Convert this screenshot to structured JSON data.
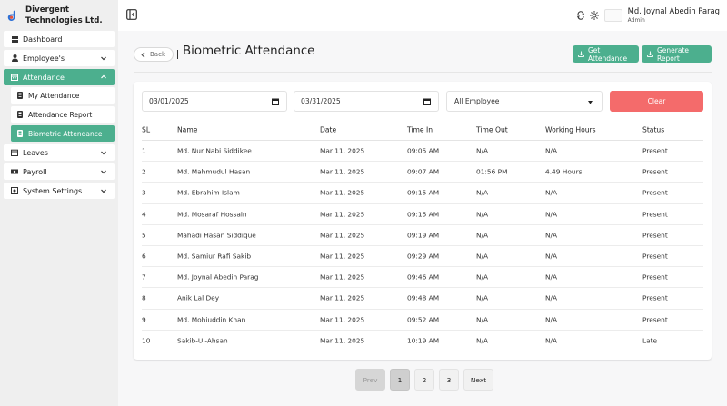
{
  "company": {
    "name": "Divergent Technologies Ltd."
  },
  "sidebar": {
    "items": [
      {
        "label": "Dashboard",
        "icon": "grid-icon"
      },
      {
        "label": "Employee's",
        "icon": "user-icon"
      },
      {
        "label": "Attendance",
        "icon": "calendar-icon"
      },
      {
        "label": "Leaves",
        "icon": "calendar-icon"
      },
      {
        "label": "Payroll",
        "icon": "money-icon"
      },
      {
        "label": "System Settings",
        "icon": "settings-icon"
      }
    ],
    "attendance_sub": [
      {
        "label": "My Attendance",
        "icon": "id-badge-icon"
      },
      {
        "label": "Attendance Report",
        "icon": "id-badge-icon"
      },
      {
        "label": "Biometric Attendance",
        "icon": "id-badge-icon"
      }
    ],
    "active_item": "Attendance",
    "active_sub": "Biometric Attendance"
  },
  "user": {
    "name": "Md. Joynal Abedin Parag",
    "role": "Admin"
  },
  "header": {
    "back_label": "Back",
    "title": "Biometric Attendance",
    "get_attendance_label": "Get Attendance",
    "generate_report_label": "Generate Report"
  },
  "filters": {
    "start_date": "03/01/2025",
    "end_date": "03/31/2025",
    "employee_select": "All Employee",
    "clear_label": "Clear"
  },
  "table": {
    "columns": [
      "SL",
      "Name",
      "Date",
      "Time In",
      "Time Out",
      "Working Hours",
      "Status"
    ],
    "rows": [
      [
        "1",
        "Md. Nur Nabi Siddikee",
        "Mar 11, 2025",
        "09:05 AM",
        "N/A",
        "N/A",
        "Present"
      ],
      [
        "2",
        "Md. Mahmudul Hasan",
        "Mar 11, 2025",
        "09:07 AM",
        "01:56 PM",
        "4.49 Hours",
        "Present"
      ],
      [
        "3",
        "Md. Ebrahim Islam",
        "Mar 11, 2025",
        "09:15 AM",
        "N/A",
        "N/A",
        "Present"
      ],
      [
        "4",
        "Md. Mosaraf Hossain",
        "Mar 11, 2025",
        "09:15 AM",
        "N/A",
        "N/A",
        "Present"
      ],
      [
        "5",
        "Mahadi Hasan Siddique",
        "Mar 11, 2025",
        "09:19 AM",
        "N/A",
        "N/A",
        "Present"
      ],
      [
        "6",
        "Md. Samiur Rafi Sakib",
        "Mar 11, 2025",
        "09:29 AM",
        "N/A",
        "N/A",
        "Present"
      ],
      [
        "7",
        "Md. Joynal Abedin Parag",
        "Mar 11, 2025",
        "09:46 AM",
        "N/A",
        "N/A",
        "Present"
      ],
      [
        "8",
        "Anik Lal Dey",
        "Mar 11, 2025",
        "09:48 AM",
        "N/A",
        "N/A",
        "Present"
      ],
      [
        "9",
        "Md. Mohiuddin Khan",
        "Mar 11, 2025",
        "09:52 AM",
        "N/A",
        "N/A",
        "Present"
      ],
      [
        "10",
        "Sakib-Ul-Ahsan",
        "Mar 11, 2025",
        "10:19 AM",
        "N/A",
        "N/A",
        "Late"
      ]
    ]
  },
  "pagination": {
    "prev_label": "Prev",
    "pages": [
      "1",
      "2",
      "3"
    ],
    "current": "1",
    "next_label": "Next"
  },
  "colors": {
    "accent": "#4caf8e",
    "danger": "#f46b6b",
    "sidebar_bg": "#efefef"
  }
}
